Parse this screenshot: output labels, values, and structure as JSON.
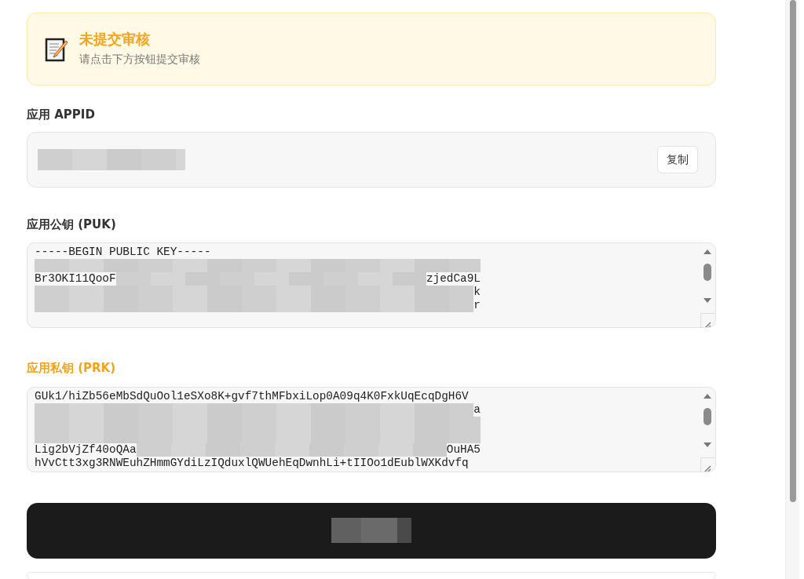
{
  "notice": {
    "title": "未提交审核",
    "subtitle": "请点击下方按钮提交审核"
  },
  "appid": {
    "label": "应用 APPID",
    "copy_button": "复制"
  },
  "public_key": {
    "label": "应用公钥 (PUK)",
    "highlighted": false,
    "lines": [
      [
        {
          "kind": "text",
          "text": "-----BEGIN PUBLIC KEY-----"
        }
      ],
      [
        {
          "kind": "redacted"
        }
      ],
      [
        {
          "kind": "text",
          "text": "Br3OKI11QooF"
        },
        {
          "kind": "redacted"
        },
        {
          "kind": "text",
          "text": "zjedCa9L"
        }
      ],
      [
        {
          "kind": "redacted"
        },
        {
          "kind": "text",
          "text": "k"
        }
      ],
      [
        {
          "kind": "redacted"
        },
        {
          "kind": "text",
          "text": "r"
        }
      ]
    ]
  },
  "private_key": {
    "label": "应用私钥 (PRK)",
    "highlighted": true,
    "lines": [
      [
        {
          "kind": "text",
          "text": "GUk1/hiZb56eMbSdQuOol1eSXo8K+gvf7thMFbxiLop0A09q4K0FxkUqEcqDgH6V"
        }
      ],
      [
        {
          "kind": "redacted"
        },
        {
          "kind": "text",
          "text": "a"
        }
      ],
      [
        {
          "kind": "redacted"
        }
      ],
      [
        {
          "kind": "redacted"
        }
      ],
      [
        {
          "kind": "text",
          "text": "Lig2bVjZf40oQAa"
        },
        {
          "kind": "redacted"
        },
        {
          "kind": "text",
          "text": "OuHA5"
        }
      ],
      [
        {
          "kind": "text",
          "text": "hVvCtt3xg3RNWEuhZHmmGYdiLzIQduxlQWUehEqDwnhLi+tIIOo1dEublWXKdvfq"
        }
      ]
    ]
  }
}
